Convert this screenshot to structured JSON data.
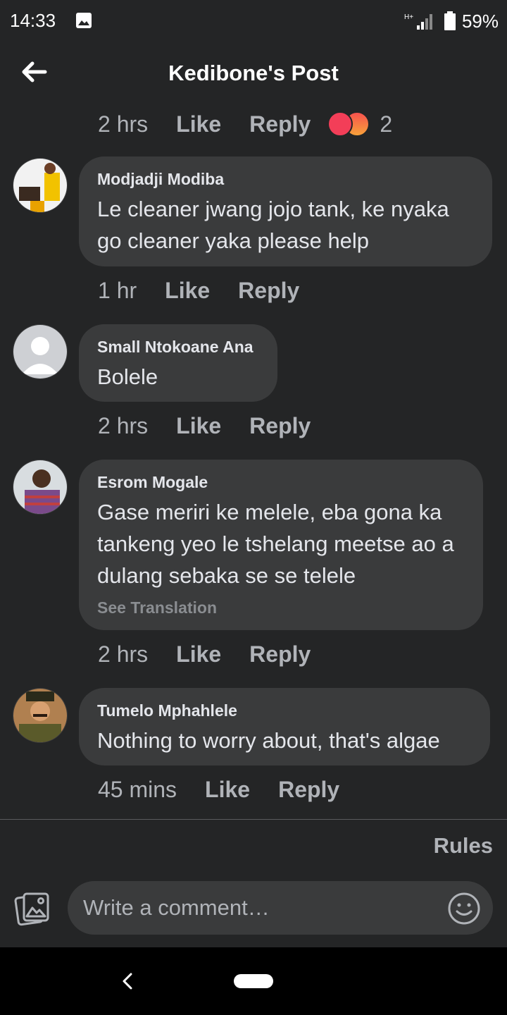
{
  "status_bar": {
    "time": "14:33",
    "network": "H+",
    "battery": "59%"
  },
  "header": {
    "title": "Kedibone's Post"
  },
  "post_meta": {
    "ago": "2 hrs",
    "like": "Like",
    "reply": "Reply",
    "reaction_count": "2",
    "reactions": [
      "love",
      "angry"
    ]
  },
  "comments": [
    {
      "author": "Modjadji Modiba",
      "text": "Le cleaner jwang jojo tank, ke nyaka go cleaner yaka please help",
      "ago": "1 hr",
      "like": "Like",
      "reply": "Reply"
    },
    {
      "author": "Small Ntokoane Ana",
      "text": "Bolele",
      "ago": "2 hrs",
      "like": "Like",
      "reply": "Reply"
    },
    {
      "author": "Esrom Mogale",
      "text": "Gase meriri ke melele, eba gona ka tankeng yeo le tshelang meetse ao a dulang sebaka se se telele",
      "see_translation": "See Translation",
      "ago": "2 hrs",
      "like": "Like",
      "reply": "Reply"
    },
    {
      "author": "Tumelo Mphahlele",
      "text": "Nothing to worry about, that's algae",
      "ago": "45 mins",
      "like": "Like",
      "reply": "Reply"
    }
  ],
  "footer": {
    "rules": "Rules",
    "input_placeholder": "Write a comment…"
  },
  "colors": {
    "background": "#242526",
    "bubble": "#3a3b3c",
    "secondary_text": "#b0b3b8",
    "love": "#f33e58"
  }
}
